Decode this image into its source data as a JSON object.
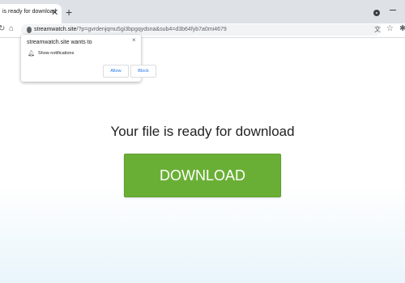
{
  "browser": {
    "tab_title": "is ready for download",
    "tab_close": "✕",
    "new_tab": "+",
    "url_host": "streamwatch.site",
    "url_path": "/?p=gvrdenjqmu5gi3bpgqydsna&sub4=d3b64fyb7a0mi4679"
  },
  "popup": {
    "title": "streamwatch.site wants to",
    "permission": "Show notifications",
    "close": "×",
    "allow_label": "Allow",
    "block_label": "Block"
  },
  "page": {
    "headline": "Your file is ready for download",
    "download_label": "DOWNLOAD"
  },
  "icons": {
    "reload": "reload-icon",
    "home": "home-icon",
    "lock": "lock-icon",
    "translate": "translate-icon",
    "star": "star-icon",
    "extension": "extension-icon",
    "bell": "bell-icon"
  },
  "colors": {
    "download_button": "#6aaf35",
    "link_blue": "#1a73e8"
  }
}
